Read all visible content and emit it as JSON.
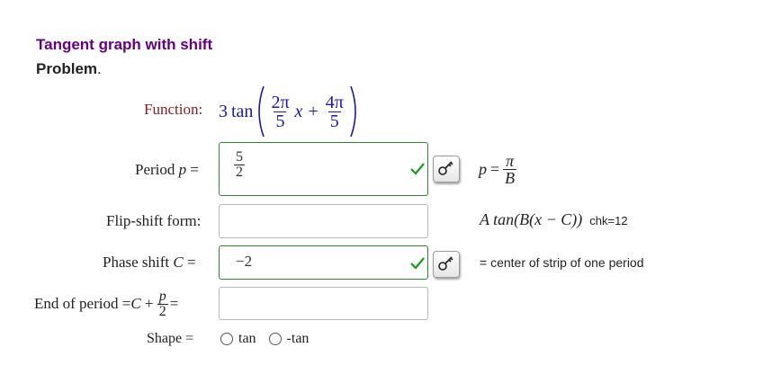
{
  "header": {
    "title": "Tangent graph with shift",
    "problem_label": "Problem",
    "problem_dot": "."
  },
  "function_row": {
    "label": "Function:",
    "coef": "3",
    "fn": "tan",
    "n1": "2π",
    "d1": "5",
    "x": "x",
    "plus": "+",
    "n2": "4π",
    "d2": "5"
  },
  "period_row": {
    "label_text": "Period ",
    "label_var": "p",
    "label_eq": " =",
    "answer_num": "5",
    "answer_den": "2",
    "hint_var": "p",
    "hint_eq": " =",
    "hint_num": "π",
    "hint_den": "B"
  },
  "flipshift_row": {
    "label": "Flip-shift form:",
    "value": "",
    "hint_formula": "A tan(B(x − C))",
    "hint_chk": "chk=12"
  },
  "phase_row": {
    "label_text": "Phase shift ",
    "label_var": "C",
    "label_eq": " =",
    "answer": "−2",
    "hint": "= center of strip of one period"
  },
  "end_row": {
    "label_text": "End of period = ",
    "label_var": "C",
    "plus": " + ",
    "frac_num": "p",
    "frac_den": "2",
    "eq": " =",
    "value": ""
  },
  "shape_row": {
    "label": "Shape =",
    "option1": "tan",
    "option2": "-tan"
  },
  "colors": {
    "title": "#660080",
    "correct_border": "#2e8b2e",
    "check": "#1a9b1a",
    "function_label": "#8b1a1a",
    "math_blue": "#1a1aa8"
  }
}
